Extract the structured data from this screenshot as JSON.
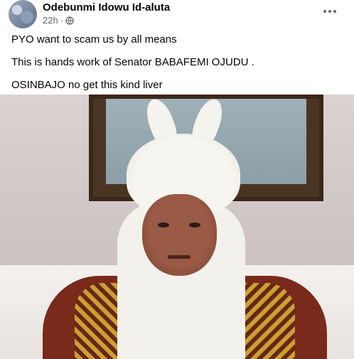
{
  "post": {
    "author": "Odebunmi Idowu Id-aluta",
    "timestamp": "22h",
    "privacy_icon": "globe-icon",
    "more_icon": "more-options-icon",
    "lines": [
      "PYO want to scam us by all means",
      "This is hands work of Senator BABAFEMI OJUDU .",
      "OSINBAJO no get this kind liver"
    ]
  }
}
